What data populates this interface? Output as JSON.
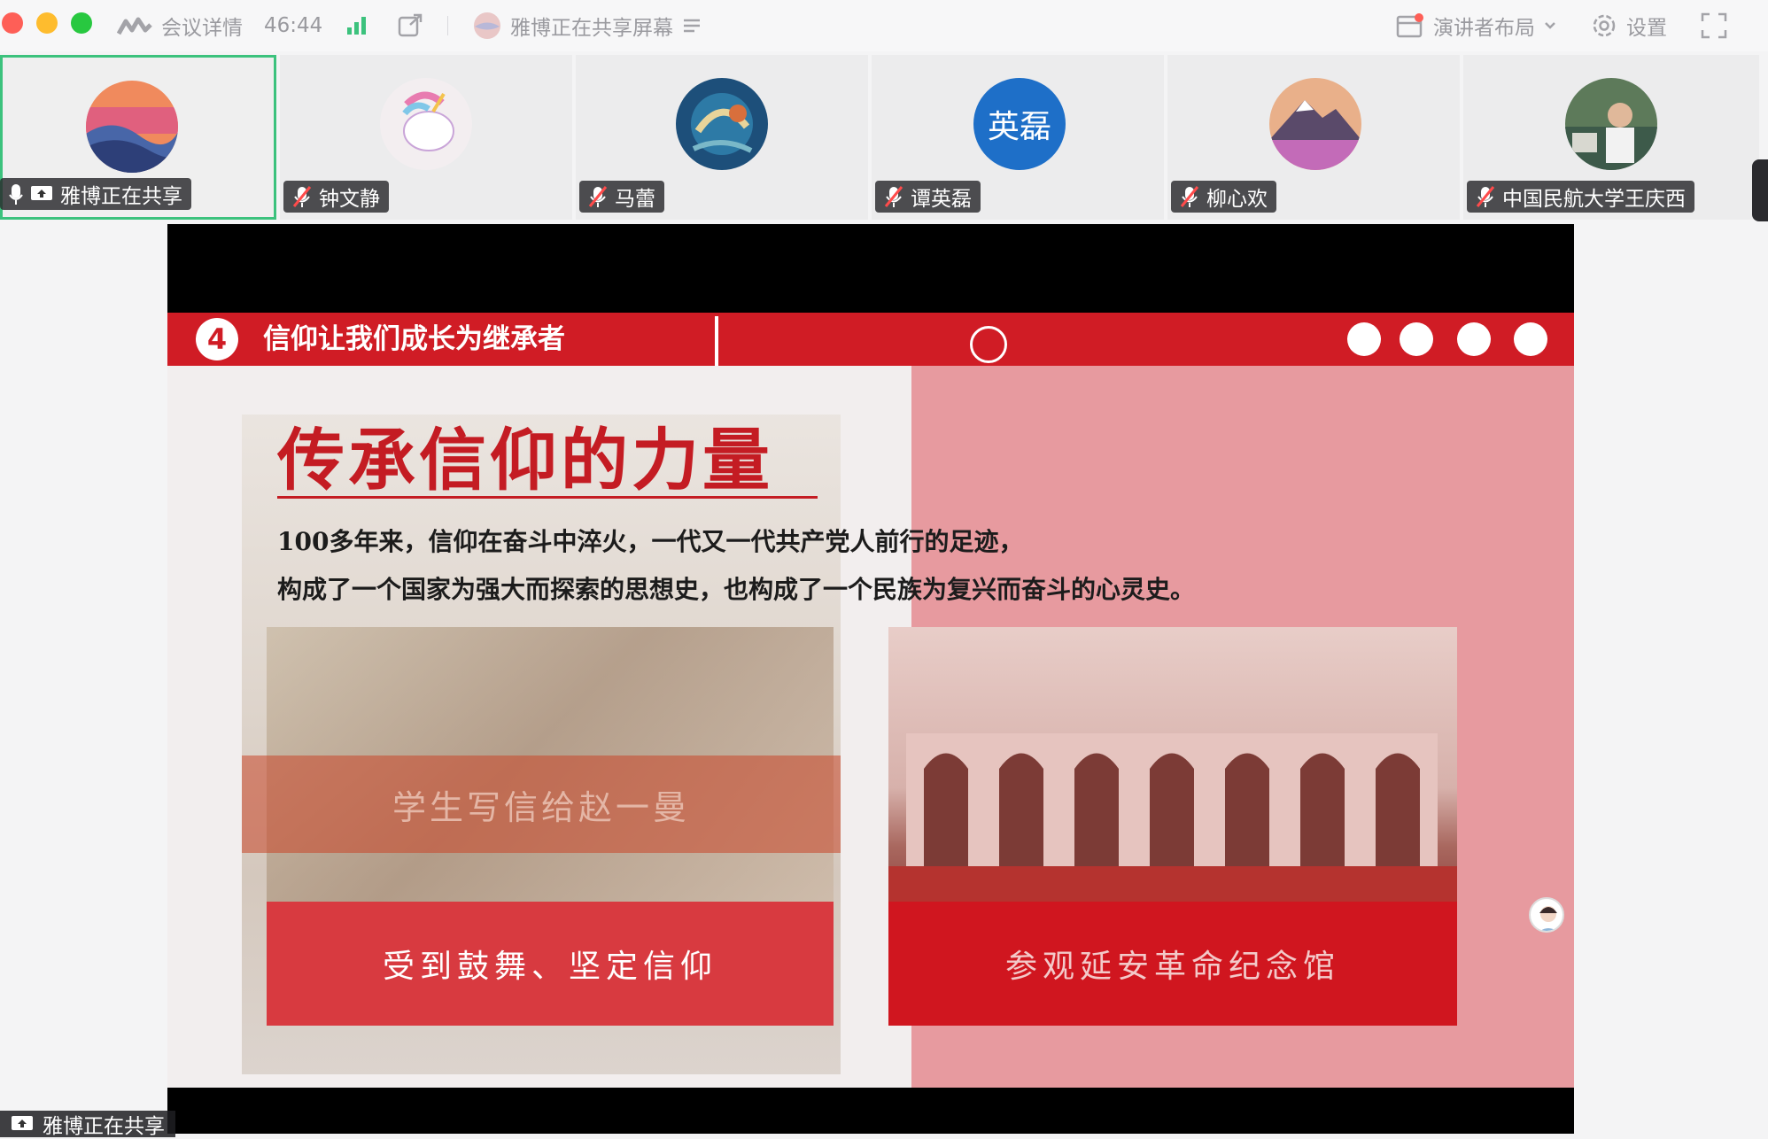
{
  "topbar": {
    "meeting_details": "会议详情",
    "timer": "46:44",
    "sharing_status": "雅博正在共享屏幕",
    "layout_label": "演讲者布局",
    "settings_label": "设置"
  },
  "participants": [
    {
      "name": "雅博正在共享"
    },
    {
      "name": "钟文静"
    },
    {
      "name": "马蕾"
    },
    {
      "name": "谭英磊",
      "avatar_text": "英磊"
    },
    {
      "name": "柳心欢"
    },
    {
      "name": "中国民航大学王庆西"
    }
  ],
  "slide": {
    "number": "4",
    "section_title": "信仰让我们成长为继承者",
    "main_title": "传承信仰的力量",
    "paragraph_line1": "100多年来，信仰在奋斗中淬火，一代又一代共产党人前行的足迹，",
    "paragraph_line2": "构成了一个国家为强大而探索的思想史，也构成了一个民族为复兴而奋斗的心灵史。",
    "left_banner": "学生写信给赵一曼",
    "left_caption": "受到鼓舞、坚定信仰",
    "right_caption": "参观延安革命纪念馆"
  },
  "bottom_tag": {
    "label": "雅博正在共享"
  },
  "colors": {
    "accent_red": "#d01c25",
    "active_border": "#3cc27d",
    "panel_pink": "#e79a9f"
  }
}
